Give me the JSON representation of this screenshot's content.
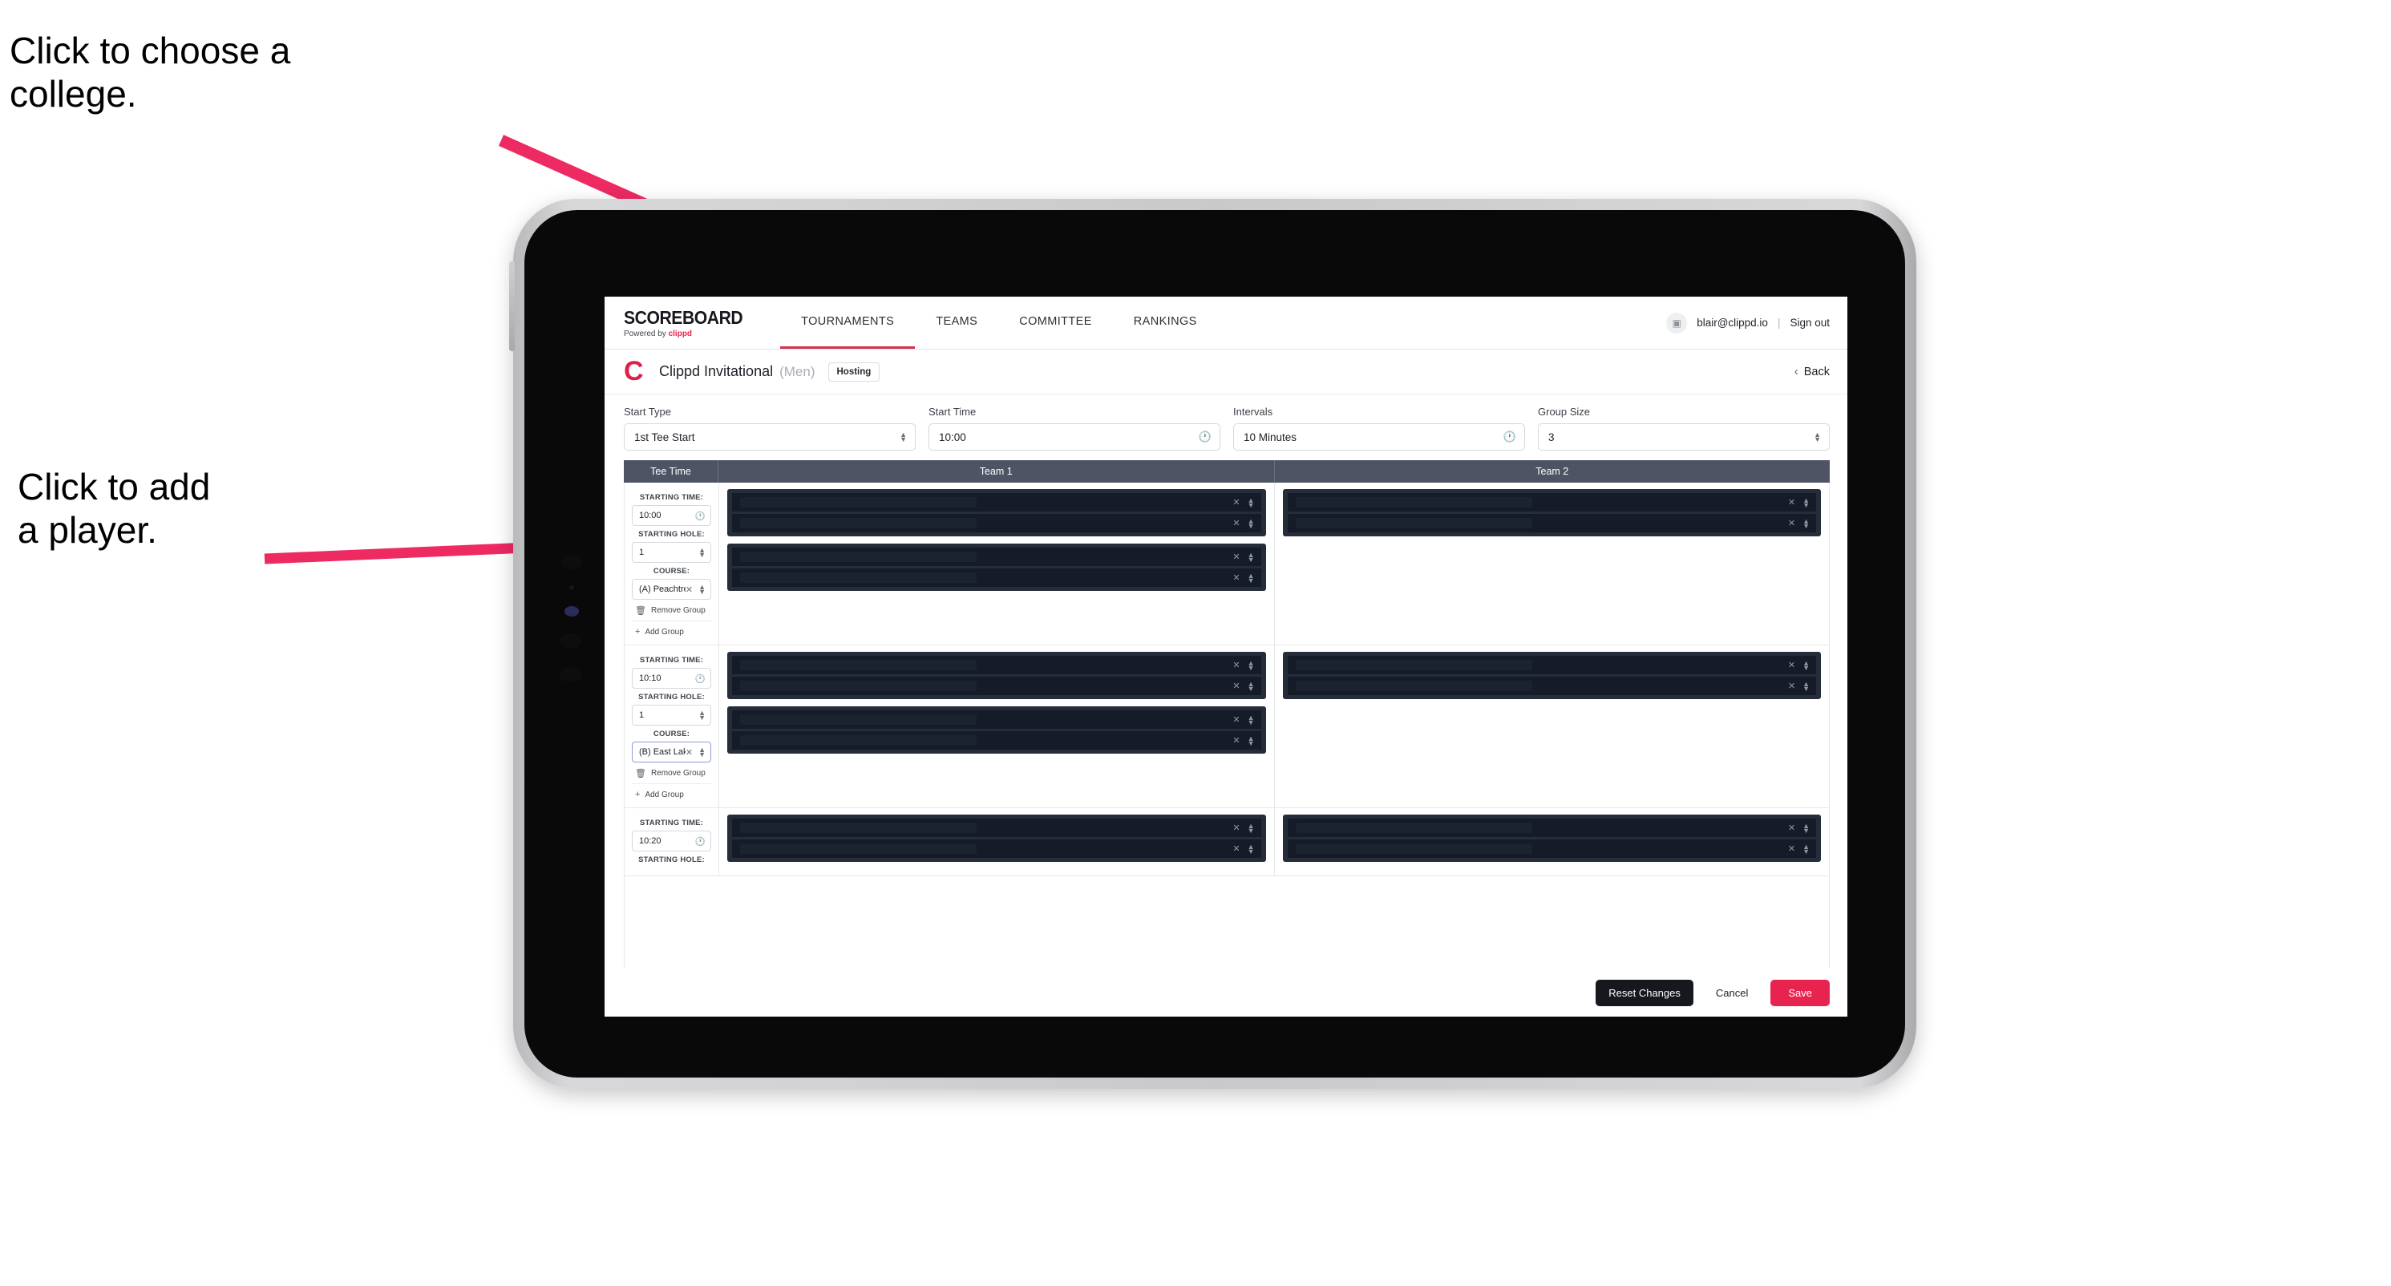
{
  "annotations": [
    {
      "id": "annot-college",
      "text": "Click to choose a\ncollege."
    },
    {
      "id": "annot-player",
      "text": "Click to add\na player."
    }
  ],
  "brand": {
    "wordmark": "SCOREBOARD",
    "powered_by": "Powered by ",
    "powered_by_brand": "clippd"
  },
  "nav": {
    "tabs": [
      {
        "label": "TOURNAMENTS",
        "active": true
      },
      {
        "label": "TEAMS",
        "active": false
      },
      {
        "label": "COMMITTEE",
        "active": false
      },
      {
        "label": "RANKINGS",
        "active": false
      }
    ],
    "avatar_icon": "user-avatar-icon",
    "email": "blair@clippd.io",
    "separator": "|",
    "sign_out": "Sign out"
  },
  "title_bar": {
    "logo_letter": "C",
    "title": "Clippd Invitational",
    "gender": "(Men)",
    "hosting_badge": "Hosting",
    "back_chevron": "‹",
    "back_label": "Back"
  },
  "controls": [
    {
      "label": "Start Type",
      "value": "1st Tee Start",
      "icon": "stepper-icon"
    },
    {
      "label": "Start Time",
      "value": "10:00",
      "icon": "clock-icon"
    },
    {
      "label": "Intervals",
      "value": "10 Minutes",
      "icon": "clock-icon"
    },
    {
      "label": "Group Size",
      "value": "3",
      "icon": "stepper-icon"
    }
  ],
  "table": {
    "headers": {
      "tee_time": "Tee Time",
      "team1": "Team 1",
      "team2": "Team 2"
    },
    "field_labels": {
      "starting_time": "STARTING TIME:",
      "starting_hole": "STARTING HOLE:",
      "course": "COURSE:"
    },
    "group_actions": {
      "remove": "Remove Group",
      "remove_icon": "trash-icon",
      "add": "Add Group",
      "add_icon": "plus-icon"
    },
    "row_icons": {
      "clear": "clear-x-icon",
      "stepper": "stepper-icon"
    },
    "groups": [
      {
        "starting_time": "10:00",
        "starting_hole": "1",
        "course": "(A) Peachtree GC",
        "course_focused": false,
        "team1_panels": [
          {
            "players": 2
          },
          {
            "players": 2
          }
        ],
        "team2_panels": [
          {
            "players": 2
          }
        ]
      },
      {
        "starting_time": "10:10",
        "starting_hole": "1",
        "course": "(B) East Lake GC",
        "course_focused": true,
        "team1_panels": [
          {
            "players": 2
          },
          {
            "players": 2
          }
        ],
        "team2_panels": [
          {
            "players": 2
          }
        ]
      },
      {
        "starting_time": "10:20",
        "starting_hole": "",
        "course": "",
        "course_focused": false,
        "team1_panels": [
          {
            "players": 2
          }
        ],
        "team2_panels": [
          {
            "players": 2
          }
        ]
      }
    ]
  },
  "footer": {
    "reset": "Reset Changes",
    "cancel": "Cancel",
    "save": "Save"
  },
  "colors": {
    "accent_pink": "#e8234f",
    "brand_red": "#e01e48",
    "table_header": "#4e5464",
    "panel_dark": "#252c3a",
    "row_dark": "#151b27",
    "annotation_arrow": "#ee2a63"
  }
}
